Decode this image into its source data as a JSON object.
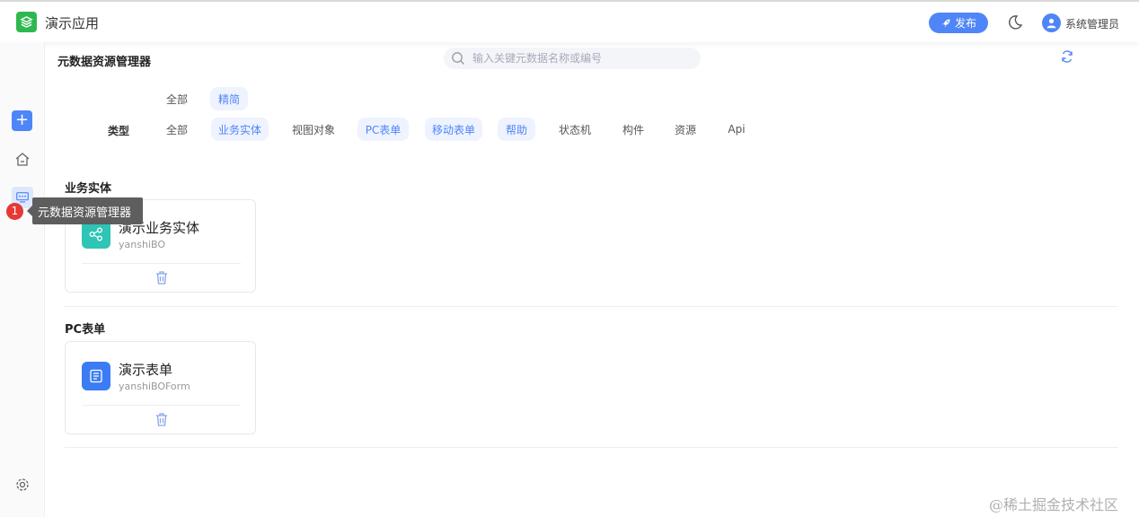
{
  "app": {
    "title": "演示应用"
  },
  "header": {
    "publish_label": "发布",
    "user_name": "系统管理员"
  },
  "sidebar": {
    "tooltip": "元数据资源管理器",
    "badge_count": "1"
  },
  "page": {
    "title": "元数据资源管理器",
    "search_placeholder": "输入关键元数据名称或编号"
  },
  "filters": {
    "mode": [
      {
        "label": "全部"
      },
      {
        "label": "精简",
        "active": true
      }
    ],
    "type_label": "类型",
    "types": [
      {
        "label": "全部"
      },
      {
        "label": "业务实体",
        "active": true
      },
      {
        "label": "视图对象"
      },
      {
        "label": "PC表单",
        "active": true
      },
      {
        "label": "移动表单",
        "active": true
      },
      {
        "label": "帮助",
        "active": true
      },
      {
        "label": "状态机"
      },
      {
        "label": "构件"
      },
      {
        "label": "资源"
      },
      {
        "label": "Api"
      }
    ]
  },
  "sections": [
    {
      "title": "业务实体",
      "cards": [
        {
          "name": "演示业务实体",
          "code": "yanshiBO",
          "icon": "entity-icon",
          "color": "#2ec4b6"
        }
      ]
    },
    {
      "title": "PC表单",
      "cards": [
        {
          "name": "演示表单",
          "code": "yanshiBOForm",
          "icon": "form-icon",
          "color": "#3b7cf5"
        }
      ]
    }
  ],
  "watermark": "@稀土掘金技术社区",
  "colors": {
    "accent": "#4f86f7",
    "logo": "#2fb850",
    "badge": "#e53935"
  }
}
